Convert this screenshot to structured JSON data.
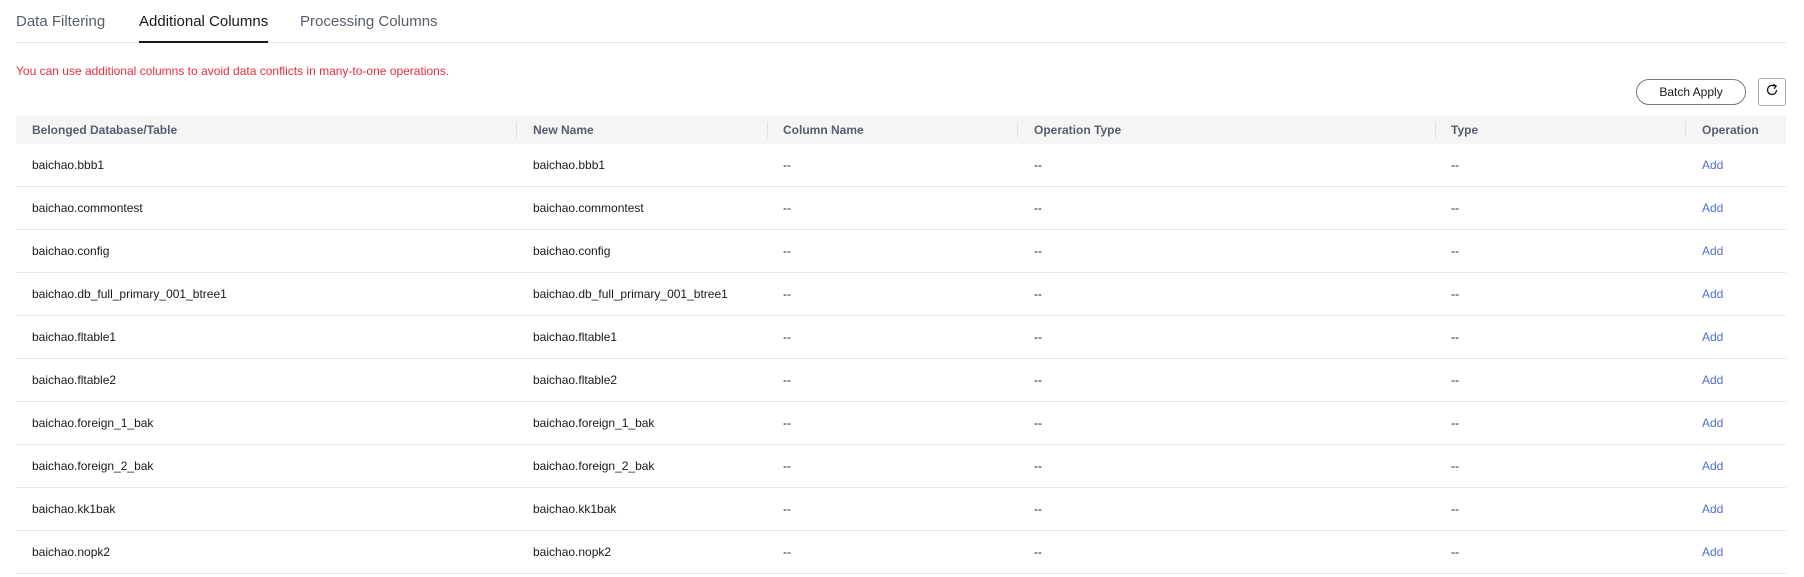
{
  "tabs": [
    {
      "label": "Data Filtering",
      "active": false
    },
    {
      "label": "Additional Columns",
      "active": true
    },
    {
      "label": "Processing Columns",
      "active": false
    }
  ],
  "notice": "You can use additional columns to avoid data conflicts in many-to-one operations.",
  "toolbar": {
    "batch_apply_label": "Batch Apply",
    "refresh_icon": "refresh-icon"
  },
  "table": {
    "columns": [
      "Belonged Database/Table",
      "New Name",
      "Column Name",
      "Operation Type",
      "Type",
      "Operation"
    ],
    "rows": [
      {
        "table": "baichao.bbb1",
        "new_name": "baichao.bbb1",
        "column_name": "--",
        "operation_type": "--",
        "type": "--",
        "operation": "Add"
      },
      {
        "table": "baichao.commontest",
        "new_name": "baichao.commontest",
        "column_name": "--",
        "operation_type": "--",
        "type": "--",
        "operation": "Add"
      },
      {
        "table": "baichao.config",
        "new_name": "baichao.config",
        "column_name": "--",
        "operation_type": "--",
        "type": "--",
        "operation": "Add"
      },
      {
        "table": "baichao.db_full_primary_001_btree1",
        "new_name": "baichao.db_full_primary_001_btree1",
        "column_name": "--",
        "operation_type": "--",
        "type": "--",
        "operation": "Add"
      },
      {
        "table": "baichao.fltable1",
        "new_name": "baichao.fltable1",
        "column_name": "--",
        "operation_type": "--",
        "type": "--",
        "operation": "Add"
      },
      {
        "table": "baichao.fltable2",
        "new_name": "baichao.fltable2",
        "column_name": "--",
        "operation_type": "--",
        "type": "--",
        "operation": "Add"
      },
      {
        "table": "baichao.foreign_1_bak",
        "new_name": "baichao.foreign_1_bak",
        "column_name": "--",
        "operation_type": "--",
        "type": "--",
        "operation": "Add"
      },
      {
        "table": "baichao.foreign_2_bak",
        "new_name": "baichao.foreign_2_bak",
        "column_name": "--",
        "operation_type": "--",
        "type": "--",
        "operation": "Add"
      },
      {
        "table": "baichao.kk1bak",
        "new_name": "baichao.kk1bak",
        "column_name": "--",
        "operation_type": "--",
        "type": "--",
        "operation": "Add"
      },
      {
        "table": "baichao.nopk2",
        "new_name": "baichao.nopk2",
        "column_name": "--",
        "operation_type": "--",
        "type": "--",
        "operation": "Add"
      }
    ]
  },
  "colors": {
    "notice": "#e62e3d",
    "link": "#526ecc",
    "header_bg": "#f5f5f5"
  }
}
